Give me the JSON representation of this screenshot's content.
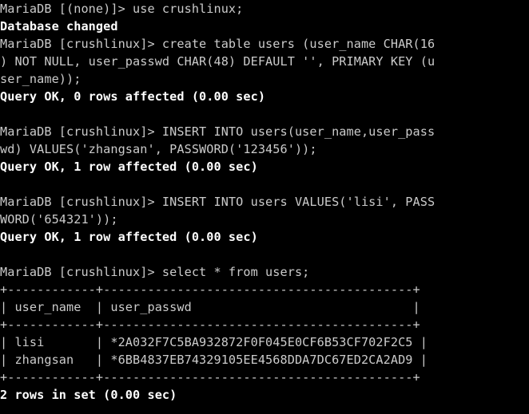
{
  "terminal": {
    "title": "MariaDB client session",
    "background_color": "#000000",
    "text_color": "#cbcbcb",
    "result_text_color": "#ffffff",
    "columns": 56,
    "rows": 24,
    "prompt_none": "MariaDB [(none)]>",
    "prompt_db": "MariaDB [crushlinux]>",
    "database": "crushlinux"
  },
  "lines": [
    {
      "name": "line-use-db",
      "kind": "echo",
      "text": "MariaDB [(none)]> use crushlinux;"
    },
    {
      "name": "line-database-changed",
      "kind": "result",
      "text": "Database changed"
    },
    {
      "name": "line-create-table-1",
      "kind": "echo",
      "text": "MariaDB [crushlinux]> create table users (user_name CHAR(16"
    },
    {
      "name": "line-create-table-2",
      "kind": "echo",
      "text": ") NOT NULL, user_passwd CHAR(48) DEFAULT '', PRIMARY KEY (u"
    },
    {
      "name": "line-create-table-3",
      "kind": "echo",
      "text": "ser_name));"
    },
    {
      "name": "line-create-table-status",
      "kind": "result",
      "text": "Query OK, 0 rows affected (0.00 sec)"
    },
    {
      "name": "line-spacer-1",
      "kind": "blank",
      "text": " "
    },
    {
      "name": "line-insert-zhangsan-1",
      "kind": "echo",
      "text": "MariaDB [crushlinux]> INSERT INTO users(user_name,user_pass"
    },
    {
      "name": "line-insert-zhangsan-2",
      "kind": "echo",
      "text": "wd) VALUES('zhangsan', PASSWORD('123456'));"
    },
    {
      "name": "line-insert-zhangsan-status",
      "kind": "result",
      "text": "Query OK, 1 row affected (0.00 sec)"
    },
    {
      "name": "line-spacer-2",
      "kind": "blank",
      "text": " "
    },
    {
      "name": "line-insert-lisi-1",
      "kind": "echo",
      "text": "MariaDB [crushlinux]> INSERT INTO users VALUES('lisi', PASS"
    },
    {
      "name": "line-insert-lisi-2",
      "kind": "echo",
      "text": "WORD('654321'));"
    },
    {
      "name": "line-insert-lisi-status",
      "kind": "result",
      "text": "Query OK, 1 row affected (0.00 sec)"
    },
    {
      "name": "line-spacer-3",
      "kind": "blank",
      "text": " "
    },
    {
      "name": "line-select-users",
      "kind": "echo",
      "text": "MariaDB [crushlinux]> select * from users;"
    },
    {
      "name": "line-table-top-border",
      "kind": "tbl",
      "text": "+------------+------------------------------------------+"
    },
    {
      "name": "line-table-header",
      "kind": "tbl",
      "text": "| user_name  | user_passwd                              |"
    },
    {
      "name": "line-table-header-border",
      "kind": "tbl",
      "text": "+------------+------------------------------------------+"
    },
    {
      "name": "line-table-row-lisi",
      "kind": "tbl",
      "text": "| lisi       | *2A032F7C5BA932872F0F045E0CF6B53CF702F2C5 |"
    },
    {
      "name": "line-table-row-zhangsan",
      "kind": "tbl",
      "text": "| zhangsan   | *6BB4837EB74329105EE4568DDA7DC67ED2CA2AD9 |"
    },
    {
      "name": "line-table-bottom-border",
      "kind": "tbl",
      "text": "+------------+------------------------------------------+"
    },
    {
      "name": "line-rows-in-set",
      "kind": "result",
      "text": "2 rows in set (0.00 sec)"
    }
  ],
  "query_result": {
    "type": "table",
    "columns": [
      "user_name",
      "user_passwd"
    ],
    "rows": [
      [
        "lisi",
        "*2A032F7C5BA932872F0F045E0CF6B53CF702F2C5"
      ],
      [
        "zhangsan",
        "*6BB4837EB74329105EE4568DDA7DC67ED2CA2AD9"
      ]
    ],
    "row_count_text": "2 rows in set (0.00 sec)",
    "row_count": 2,
    "elapsed": "0.00 sec"
  }
}
